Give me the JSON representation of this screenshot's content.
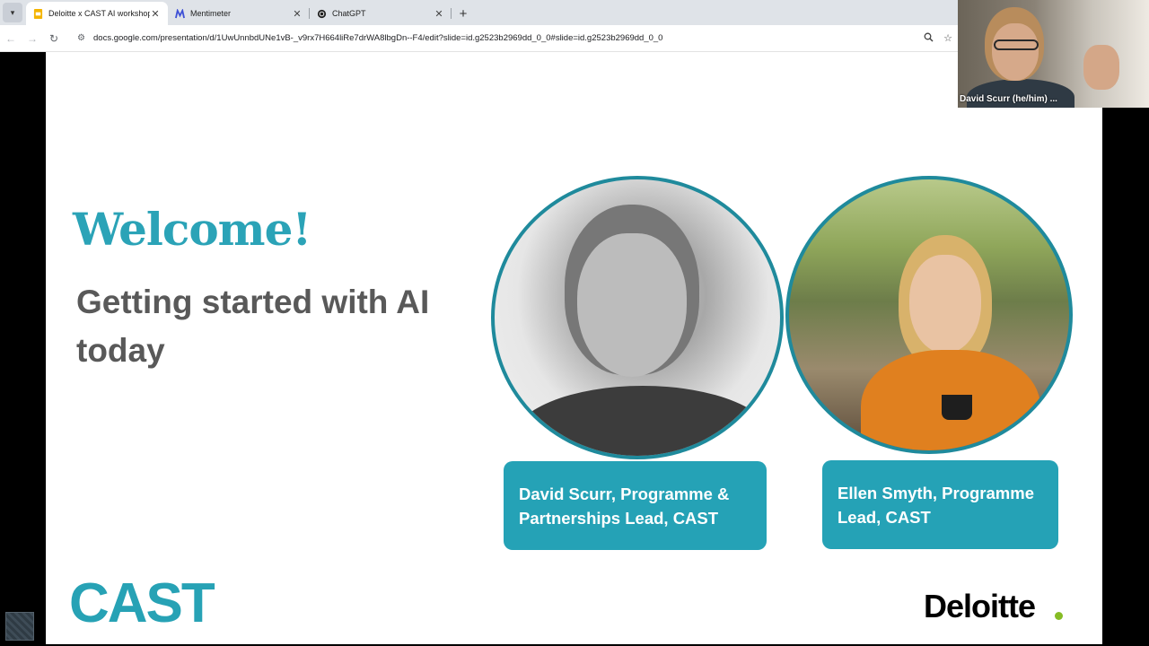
{
  "browser": {
    "tabs": [
      {
        "label": "Deloitte x CAST AI workshops#",
        "active": true,
        "favicon": "slides-icon"
      },
      {
        "label": "Mentimeter",
        "active": false,
        "favicon": "mentimeter-icon"
      },
      {
        "label": "ChatGPT",
        "active": false,
        "favicon": "chatgpt-icon"
      }
    ],
    "close_glyph": "✕",
    "new_tab_glyph": "+",
    "url": "docs.google.com/presentation/d/1UwUnnbdUNe1vB-_v9rx7H664liRe7drWA8lbgDn--F4/edit?slide=id.g2523b2969dd_0_0#slide=id.g2523b2969dd_0_0"
  },
  "slide": {
    "heading": "Welcome!",
    "subtitle": "Getting started with AI today",
    "presenters": [
      {
        "caption": "David Scurr,  Programme & Partnerships Lead, CAST"
      },
      {
        "caption": "Ellen Smyth, Programme Lead, CAST"
      }
    ],
    "logos": {
      "left": "CAST",
      "right": "Deloitte"
    },
    "colors": {
      "accent": "#2ba3b7",
      "name_box": "#25a2b6",
      "deloitte_dot": "#86bc25"
    }
  },
  "video_call": {
    "participant_name": "David Scurr (he/him) ..."
  }
}
